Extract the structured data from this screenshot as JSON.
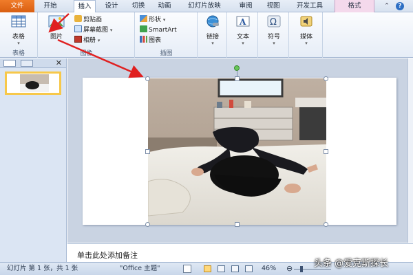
{
  "tabs": [
    {
      "label": "文件",
      "kind": "file"
    },
    {
      "label": "开始",
      "kind": "normal"
    },
    {
      "label": "插入",
      "kind": "active"
    },
    {
      "label": "设计",
      "kind": "normal"
    },
    {
      "label": "切换",
      "kind": "normal"
    },
    {
      "label": "动画",
      "kind": "normal"
    },
    {
      "label": "幻灯片放映",
      "kind": "normal"
    },
    {
      "label": "审阅",
      "kind": "normal"
    },
    {
      "label": "视图",
      "kind": "normal"
    },
    {
      "label": "开发工具",
      "kind": "normal"
    },
    {
      "label": "格式",
      "kind": "format"
    }
  ],
  "ribbon": {
    "tables": {
      "button": "表格",
      "group": "表格"
    },
    "images": {
      "picture": "图片",
      "clipart": "剪贴画",
      "screenshot": "屏幕截图",
      "album": "相册",
      "group": "图像"
    },
    "illustrations": {
      "shapes": "形状",
      "smartart": "SmartArt",
      "chart": "图表",
      "group": "插图"
    },
    "links": {
      "button": "链接"
    },
    "text": {
      "button": "文本"
    },
    "symbols": {
      "button": "符号"
    },
    "media": {
      "button": "媒体"
    }
  },
  "slides_panel": {
    "number": "1"
  },
  "notes_placeholder": "单击此处添加备注",
  "status": {
    "slide_info": "幻灯片 第 1 张，共 1 张",
    "theme": "\"Office 主题\"",
    "zoom": "46%",
    "zoom_level": 0.46
  },
  "watermark": "头条 @爱克斯探长",
  "colors": {
    "file_tab": "#e46c1f",
    "format_tab": "#f4d9ec",
    "arrow": "#e02020",
    "accent": "#2d6fc4"
  }
}
